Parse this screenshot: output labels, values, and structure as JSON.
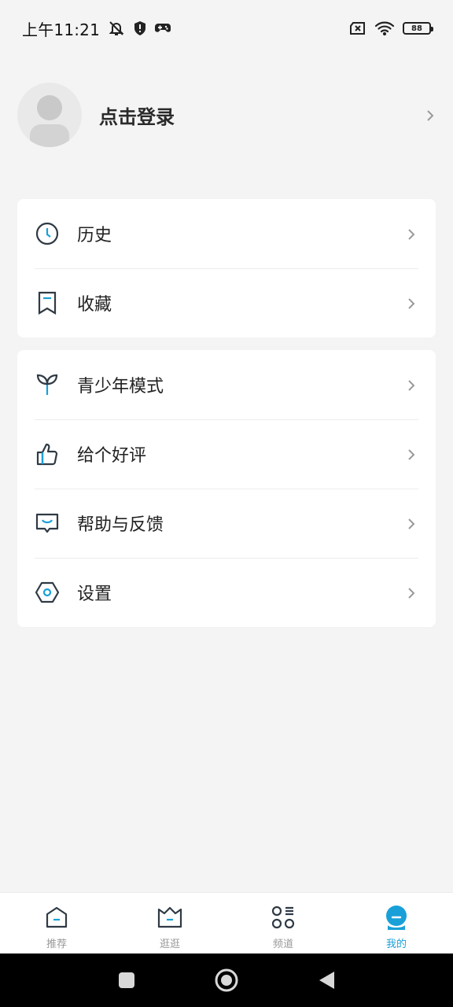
{
  "status_bar": {
    "time": "上午11:21",
    "battery_level": "88",
    "icons": [
      "mute-bell-icon",
      "shield-icon",
      "gamepad-icon",
      "no-sim-icon",
      "wifi-icon",
      "battery-icon"
    ]
  },
  "profile": {
    "login_label": "点击登录"
  },
  "menu_group_1": [
    {
      "label": "历史",
      "icon": "clock-icon"
    },
    {
      "label": "收藏",
      "icon": "bookmark-icon"
    }
  ],
  "menu_group_2": [
    {
      "label": "青少年模式",
      "icon": "sprout-icon"
    },
    {
      "label": "给个好评",
      "icon": "thumbs-up-icon"
    },
    {
      "label": "帮助与反馈",
      "icon": "feedback-icon"
    },
    {
      "label": "设置",
      "icon": "settings-icon"
    }
  ],
  "tabs": [
    {
      "label": "推荐",
      "icon": "home-icon",
      "active": false
    },
    {
      "label": "逛逛",
      "icon": "basket-icon",
      "active": false
    },
    {
      "label": "频道",
      "icon": "channels-icon",
      "active": false
    },
    {
      "label": "我的",
      "icon": "profile-icon",
      "active": true
    }
  ],
  "colors": {
    "accent": "#1aa0d8",
    "icon_stroke": "#2f3a44",
    "background": "#f4f4f4"
  }
}
